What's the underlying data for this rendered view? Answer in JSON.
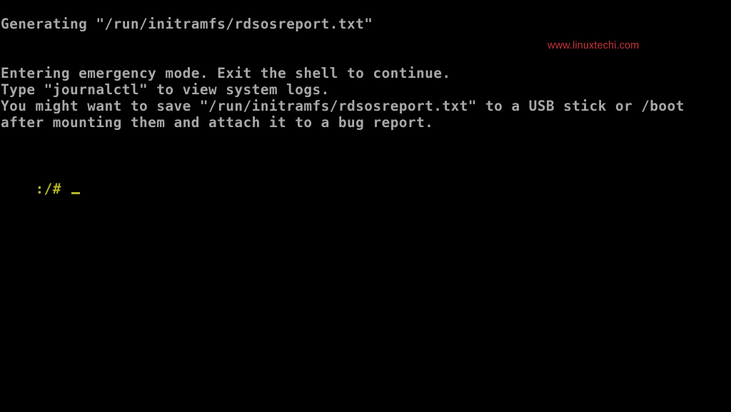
{
  "console": {
    "lines": {
      "generating": "Generating \"/run/initramfs/rdsosreport.txt\"",
      "entering": "Entering emergency mode. Exit the shell to continue.",
      "type": "Type \"journalctl\" to view system logs.",
      "save": "You might want to save \"/run/initramfs/rdsosreport.txt\" to a USB stick or /boot",
      "after": "after mounting them and attach it to a bug report."
    },
    "prompt": ":/# ",
    "colors": {
      "background": "#000000",
      "text": "#a8a8a8",
      "prompt": "#b5b52a"
    }
  },
  "watermark": {
    "text": "www.linuxtechi.com",
    "color": "#c8333b"
  }
}
